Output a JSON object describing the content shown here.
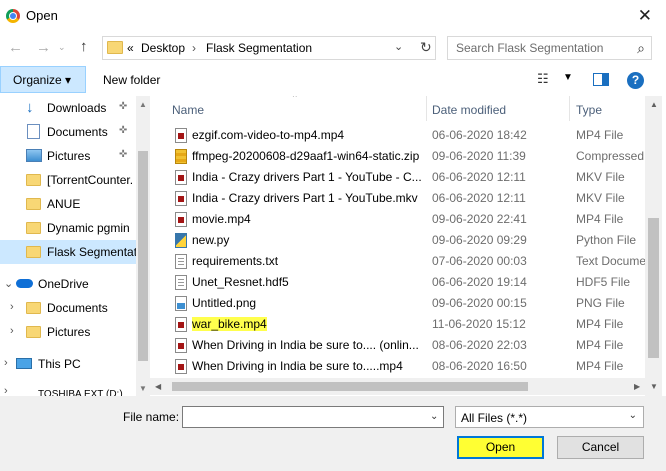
{
  "window": {
    "title": "Open",
    "close": "✕"
  },
  "nav": {
    "back": "←",
    "forward": "→",
    "up": "↑",
    "address": {
      "chevron_left": "«",
      "crumb1": "Desktop",
      "sep": "›",
      "crumb2": "Flask Segmentation",
      "dropdown": "⌄",
      "refresh": "↻"
    },
    "search_placeholder": "Search Flask Segmentation"
  },
  "toolbar": {
    "organize": "Organize ▾",
    "new_folder": "New folder",
    "help": "?"
  },
  "sidebar": {
    "items": [
      {
        "label": "Downloads",
        "pinned": true
      },
      {
        "label": "Documents",
        "pinned": true
      },
      {
        "label": "Pictures",
        "pinned": true
      },
      {
        "label": "[TorrentCounter."
      },
      {
        "label": "ANUE"
      },
      {
        "label": "Dynamic pgmin"
      },
      {
        "label": "Flask Segmentat",
        "selected": true
      },
      {
        "label": "OneDrive"
      },
      {
        "label": "Documents"
      },
      {
        "label": "Pictures"
      },
      {
        "label": "This PC"
      },
      {
        "label": "TOSHIBA EXT (D:)"
      }
    ],
    "pin_glyph": "📌"
  },
  "columns": {
    "name": "Name",
    "date": "Date modified",
    "type": "Type"
  },
  "files": [
    {
      "name": "ezgif.com-video-to-mp4.mp4",
      "date": "06-06-2020 18:42",
      "type": "MP4 File",
      "icon": "video"
    },
    {
      "name": "ffmpeg-20200608-d29aaf1-win64-static.zip",
      "date": "09-06-2020 11:39",
      "type": "Compressed",
      "icon": "zip"
    },
    {
      "name": "India - Crazy drivers Part 1 - YouTube - C...",
      "date": "06-06-2020 12:11",
      "type": "MKV File",
      "icon": "video"
    },
    {
      "name": "India - Crazy drivers Part 1 - YouTube.mkv",
      "date": "06-06-2020 12:11",
      "type": "MKV File",
      "icon": "video"
    },
    {
      "name": "movie.mp4",
      "date": "09-06-2020 22:41",
      "type": "MP4 File",
      "icon": "video"
    },
    {
      "name": "new.py",
      "date": "09-06-2020 09:29",
      "type": "Python File",
      "icon": "py"
    },
    {
      "name": "requirements.txt",
      "date": "07-06-2020 00:03",
      "type": "Text Docume",
      "icon": "txt"
    },
    {
      "name": "Unet_Resnet.hdf5",
      "date": "06-06-2020 19:14",
      "type": "HDF5 File",
      "icon": "txt"
    },
    {
      "name": "Untitled.png",
      "date": "09-06-2020 00:15",
      "type": "PNG File",
      "icon": "img"
    },
    {
      "name": "war_bike.mp4",
      "date": "11-06-2020 15:12",
      "type": "MP4 File",
      "icon": "video",
      "highlight": true
    },
    {
      "name": "When Driving in India be sure to.... (onlin...",
      "date": "08-06-2020 22:03",
      "type": "MP4 File",
      "icon": "video"
    },
    {
      "name": "When Driving in India be sure to.....mp4",
      "date": "08-06-2020 16:50",
      "type": "MP4 File",
      "icon": "video"
    }
  ],
  "bottom": {
    "file_name_label": "File name:",
    "file_name_value": "",
    "filter": "All Files (*.*)",
    "open": "Open",
    "cancel": "Cancel"
  }
}
